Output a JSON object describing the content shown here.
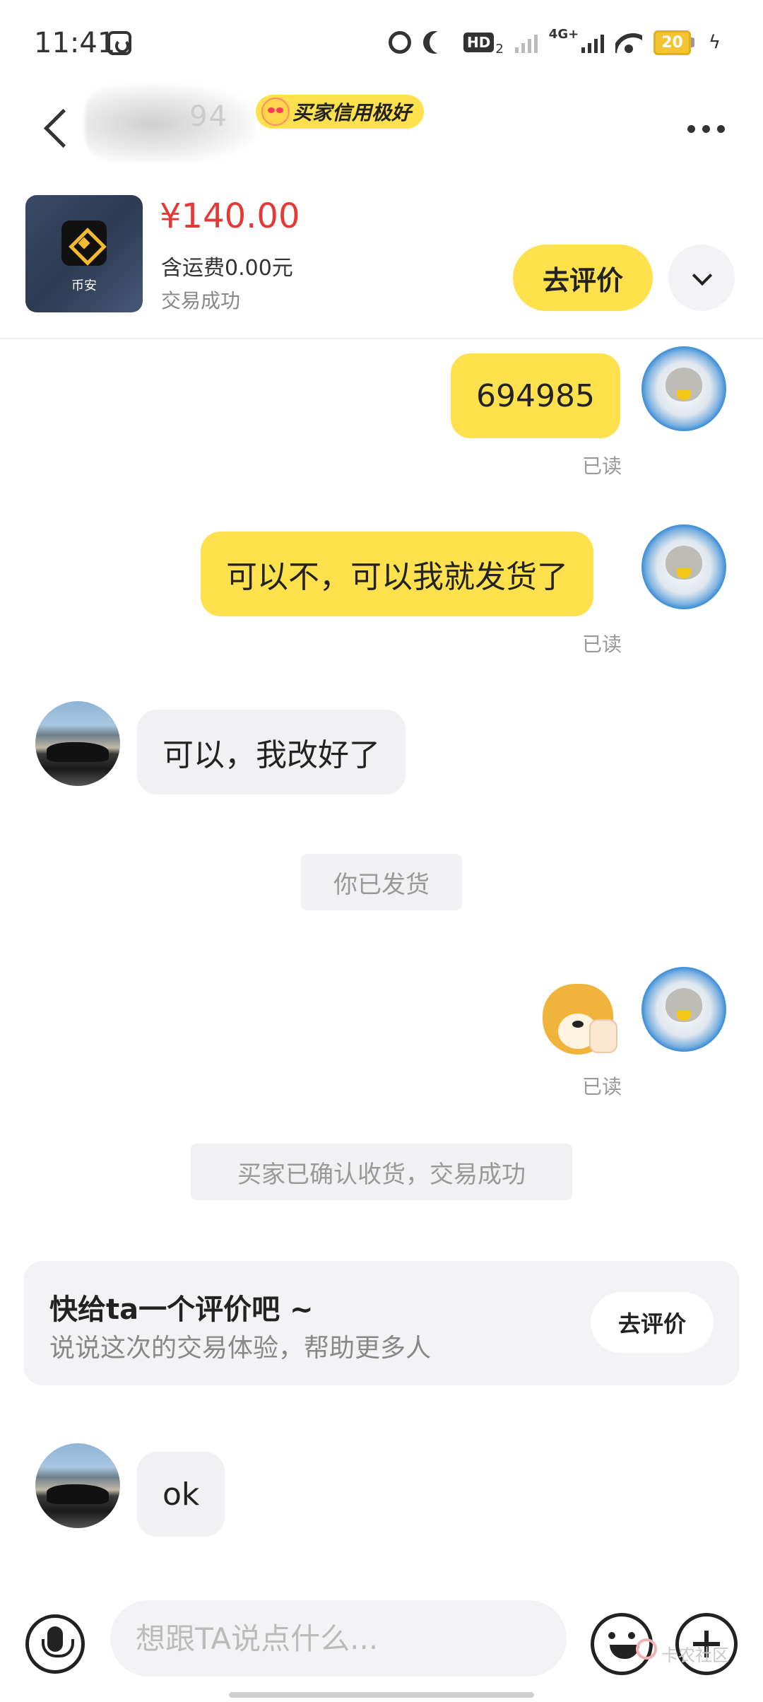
{
  "status_bar": {
    "time": "11:41",
    "hd_label": "HD",
    "hd_sub": "2",
    "network": "4G+",
    "battery": "20"
  },
  "header": {
    "username_partial": "94",
    "credit_badge": "买家信用极好"
  },
  "product": {
    "brand": "币安",
    "price": "¥140.00",
    "shipping": "含运费0.00元",
    "status": "交易成功",
    "review_button": "去评价"
  },
  "messages": {
    "m1": "694985",
    "m1_read": "已读",
    "m2": "可以不，可以我就发货了",
    "m2_read": "已读",
    "m3": "可以，我改好了",
    "sys1": "你已发货",
    "m4_read": "已读",
    "sys2": "买家已确认收货，交易成功",
    "m5": "ok"
  },
  "review_card": {
    "title": "快给ta一个评价吧 ~",
    "subtitle": "说说这次的交易体验，帮助更多人",
    "button": "去评价"
  },
  "input_bar": {
    "placeholder": "想跟TA说点什么..."
  },
  "watermark": "卡农社区"
}
